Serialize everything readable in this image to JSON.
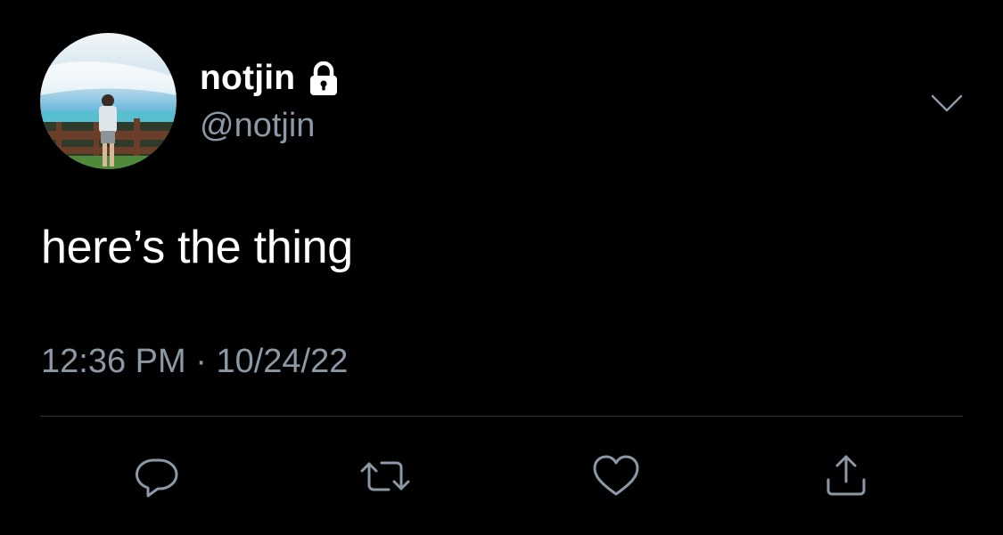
{
  "tweet": {
    "author": {
      "display_name": "notjin",
      "handle": "@notjin",
      "protected_icon": "lock-icon",
      "avatar_description": "photo-avatar"
    },
    "menu_icon": "chevron-down-icon",
    "text": "here’s the thing",
    "time": "12:36 PM",
    "separator": " · ",
    "date": "10/24/22",
    "actions": [
      {
        "name": "reply",
        "icon": "reply-icon"
      },
      {
        "name": "retweet",
        "icon": "retweet-icon"
      },
      {
        "name": "like",
        "icon": "heart-icon"
      },
      {
        "name": "share",
        "icon": "share-icon"
      }
    ]
  },
  "colors": {
    "background": "#000000",
    "primary_text": "#ffffff",
    "secondary_text": "#8b98a5",
    "divider": "#2f3336",
    "icon": "#8b98a5"
  }
}
